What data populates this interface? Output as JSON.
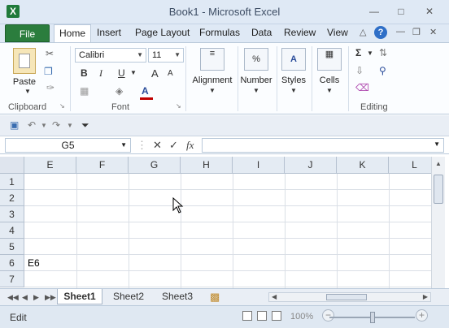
{
  "window": {
    "title": "Book1  -  Microsoft Excel",
    "app_icon": "X"
  },
  "ribbon_tabs": {
    "file": "File",
    "tabs": [
      "Home",
      "Insert",
      "Page Layout",
      "Formulas",
      "Data",
      "Review",
      "View"
    ],
    "active": "Home"
  },
  "ribbon": {
    "clipboard": {
      "paste_label": "Paste",
      "group_label": "Clipboard"
    },
    "font": {
      "name": "Calibri",
      "size": "11",
      "group_label": "Font",
      "bold": "B",
      "italic": "I",
      "underline": "U",
      "grow": "A",
      "shrink": "A",
      "font_color": "A"
    },
    "alignment": {
      "label": "Alignment"
    },
    "number": {
      "label": "Number",
      "icon_text": "%"
    },
    "styles": {
      "label": "Styles"
    },
    "cells": {
      "label": "Cells"
    },
    "editing": {
      "group_label": "Editing",
      "sum_icon": "Σ"
    }
  },
  "formula_bar": {
    "name_box": "G5",
    "fx": "fx",
    "formula": ""
  },
  "grid": {
    "columns": [
      "E",
      "F",
      "G",
      "H",
      "I",
      "J",
      "K",
      "L"
    ],
    "rows": [
      "1",
      "2",
      "3",
      "4",
      "5",
      "6",
      "7"
    ],
    "cells": [
      {
        "text": "E6"
      }
    ]
  },
  "sheets": {
    "tabs": [
      "Sheet1",
      "Sheet2",
      "Sheet3"
    ],
    "active": "Sheet1"
  },
  "status": {
    "mode": "Edit",
    "zoom": "100%"
  }
}
